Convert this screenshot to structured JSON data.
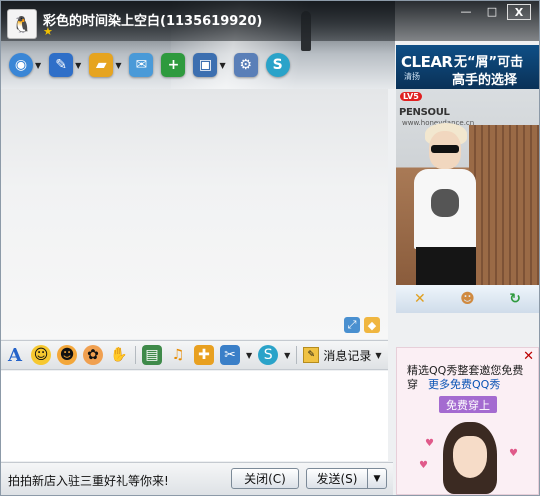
{
  "window": {
    "contact_name": "彩色的时间染上空白(1135619920)",
    "buttons": {
      "minimize": "—",
      "maximize": "□",
      "close": "X"
    }
  },
  "toolbar": {
    "items": [
      {
        "name": "video",
        "icon": "webcam-icon",
        "color": "#3a86d6",
        "glyph": "◉"
      },
      {
        "name": "voice",
        "icon": "microphone-icon",
        "color": "#2f6fc8",
        "glyph": "🎤"
      },
      {
        "name": "transfer-file",
        "icon": "folder-icon",
        "color": "#e6a420",
        "glyph": "📁"
      },
      {
        "name": "send-sms",
        "icon": "message-icon",
        "color": "#4a9ad8",
        "glyph": "✉"
      },
      {
        "name": "create-discussion",
        "icon": "add-group-icon",
        "color": "#2e9a3e",
        "glyph": "+"
      },
      {
        "name": "remote-assist",
        "icon": "monitor-icon",
        "color": "#3c6fb0",
        "glyph": "▣"
      },
      {
        "name": "app-settings",
        "icon": "settings-icon",
        "color": "#5a7fb8",
        "glyph": "⚙"
      },
      {
        "name": "soso",
        "icon": "soso-icon",
        "color": "#2aa3c9",
        "glyph": "S"
      }
    ]
  },
  "format_bar": {
    "history_label": "消息记录"
  },
  "input": {
    "value": ""
  },
  "bottom": {
    "ad_text": "拍拍新店入驻三重好礼等你来!",
    "close_label": "关闭(C)",
    "send_label": "发送(S)",
    "send_menu": "▼"
  },
  "right_panel": {
    "banner": {
      "brand": "CLEAR",
      "brand_sub": "清扬",
      "line1": "无“屑”可击",
      "line2": "高手的选择"
    },
    "show": {
      "level_badge": "LV5",
      "logo_text": "PENSOUL",
      "url_text": "www.honeydance.cn"
    },
    "show_ad": {
      "text": "精选QQ秀整套邀您免费穿",
      "link": "更多免费QQ秀",
      "button": "免费穿上"
    }
  },
  "colors": {
    "title_text": "#ffffff",
    "link_blue": "#0a53b5",
    "ad_purple": "#a46bd0",
    "banner_blue": "#0f4f86"
  }
}
